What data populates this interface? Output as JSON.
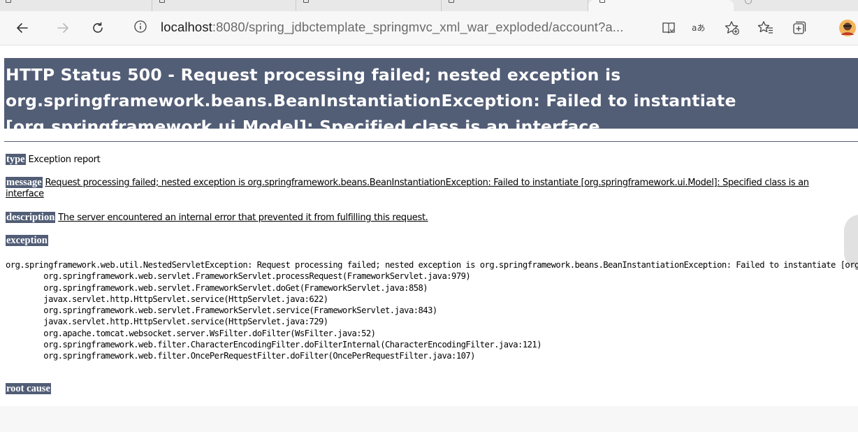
{
  "browser": {
    "address": {
      "host": "localhost",
      "path": ":8080/spring_jdbctemplate_springmvc_xml_war_exploded/account?a..."
    },
    "tab_count": 6
  },
  "page": {
    "title_line1": "HTTP Status 500 - Request processing failed; nested exception is",
    "title_line2": "org.springframework.beans.BeanInstantiationException: Failed to instantiate",
    "title_line3": "[org.springframework.ui.Model]: Specified class is an interface",
    "type_label": "type",
    "type_value": "Exception report",
    "message_label": "message",
    "message_line1": "Request processing failed; nested exception is org.springframework.beans.BeanInstantiationException: Failed to instantiate [org.springframework.ui.Model]: Specified class is an",
    "message_line2": "interface",
    "description_label": "description",
    "description_value": "The server encountered an internal error that prevented it from fulfilling this request.",
    "exception_label": "exception",
    "trace": [
      "org.springframework.web.util.NestedServletException: Request processing failed; nested exception is org.springframework.beans.BeanInstantiationException: Failed to instantiate [org.springframework.ui.Model]: Specified class is an interface",
      "\torg.springframework.web.servlet.FrameworkServlet.processRequest(FrameworkServlet.java:979)",
      "\torg.springframework.web.servlet.FrameworkServlet.doGet(FrameworkServlet.java:858)",
      "\tjavax.servlet.http.HttpServlet.service(HttpServlet.java:622)",
      "\torg.springframework.web.servlet.FrameworkServlet.service(FrameworkServlet.java:843)",
      "\tjavax.servlet.http.HttpServlet.service(HttpServlet.java:729)",
      "\torg.apache.tomcat.websocket.server.WsFilter.doFilter(WsFilter.java:52)",
      "\torg.springframework.web.filter.CharacterEncodingFilter.doFilterInternal(CharacterEncodingFilter.java:121)",
      "\torg.springframework.web.filter.OncePerRequestFilter.doFilter(OncePerRequestFilter.java:107)"
    ],
    "root_cause_label": "root cause"
  },
  "colors": {
    "label_bg": "#525d76",
    "chrome_bg": "#f7f7f7"
  },
  "icons": [
    "back-icon",
    "forward-icon",
    "refresh-icon",
    "info-icon",
    "immersive-reader-icon",
    "read-aloud-icon",
    "add-favorite-icon",
    "favorites-icon",
    "collections-icon",
    "profile-avatar-icon"
  ]
}
